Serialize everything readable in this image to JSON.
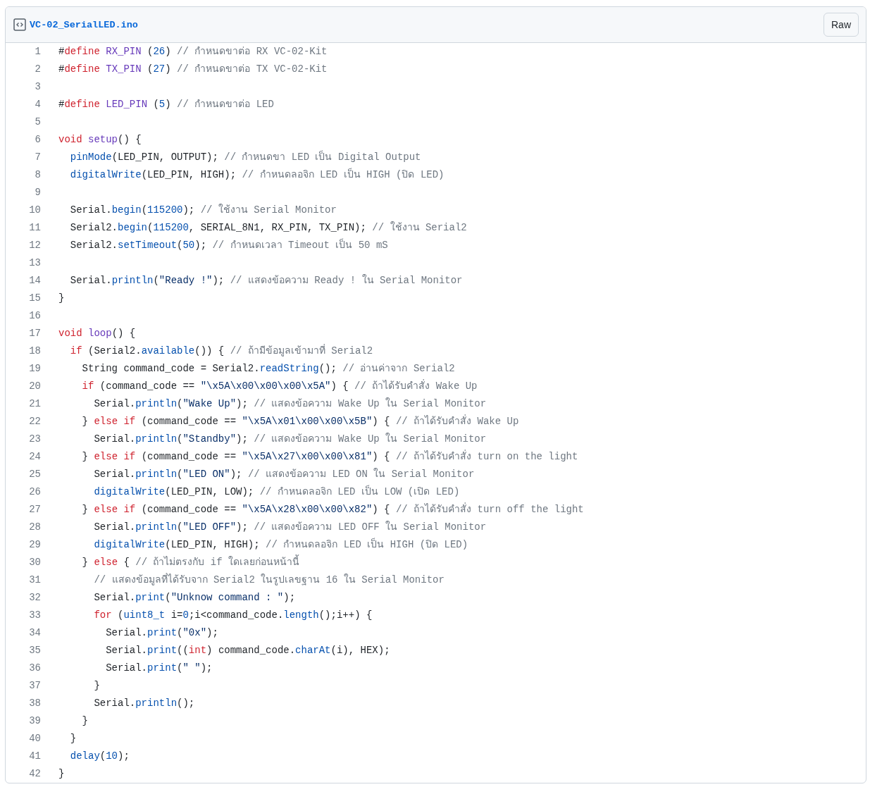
{
  "file": {
    "name": "VC-02_SerialLED.ino",
    "raw_button": "Raw"
  },
  "lines": [
    {
      "number": "1",
      "tokens": [
        {
          "kind": "plain",
          "text": "#"
        },
        {
          "kind": "keyword",
          "text": "define"
        },
        {
          "kind": "entity",
          "text": " RX_PIN"
        },
        {
          "kind": "plain",
          "text": " ("
        },
        {
          "kind": "constant",
          "text": "26"
        },
        {
          "kind": "plain",
          "text": ") "
        },
        {
          "kind": "comment",
          "text": "// กำหนดขาต่อ RX VC-02-Kit"
        }
      ]
    },
    {
      "number": "2",
      "tokens": [
        {
          "kind": "plain",
          "text": "#"
        },
        {
          "kind": "keyword",
          "text": "define"
        },
        {
          "kind": "entity",
          "text": " TX_PIN"
        },
        {
          "kind": "plain",
          "text": " ("
        },
        {
          "kind": "constant",
          "text": "27"
        },
        {
          "kind": "plain",
          "text": ") "
        },
        {
          "kind": "comment",
          "text": "// กำหนดขาต่อ TX VC-02-Kit"
        }
      ]
    },
    {
      "number": "3"
    },
    {
      "number": "4",
      "tokens": [
        {
          "kind": "plain",
          "text": "#"
        },
        {
          "kind": "keyword",
          "text": "define"
        },
        {
          "kind": "entity",
          "text": " LED_PIN"
        },
        {
          "kind": "plain",
          "text": " ("
        },
        {
          "kind": "constant",
          "text": "5"
        },
        {
          "kind": "plain",
          "text": ") "
        },
        {
          "kind": "comment",
          "text": "// กำหนดขาต่อ LED"
        }
      ]
    },
    {
      "number": "5"
    },
    {
      "number": "6",
      "tokens": [
        {
          "kind": "keyword",
          "text": "void"
        },
        {
          "kind": "entity",
          "text": " setup"
        },
        {
          "kind": "plain",
          "text": "() {"
        }
      ]
    },
    {
      "number": "7",
      "tokens": [
        {
          "kind": "constant",
          "text": "  pinMode"
        },
        {
          "kind": "plain",
          "text": "(LED_PIN, OUTPUT); "
        },
        {
          "kind": "comment",
          "text": "// กำหนดขา LED เป็น Digital Output"
        }
      ]
    },
    {
      "number": "8",
      "tokens": [
        {
          "kind": "constant",
          "text": "  digitalWrite"
        },
        {
          "kind": "plain",
          "text": "(LED_PIN, HIGH); "
        },
        {
          "kind": "comment",
          "text": "// กำหนดลอจิก LED เป็น HIGH (ปิด LED)"
        }
      ]
    },
    {
      "number": "9"
    },
    {
      "number": "10",
      "tokens": [
        {
          "kind": "plain",
          "text": "  Serial."
        },
        {
          "kind": "constant",
          "text": "begin"
        },
        {
          "kind": "plain",
          "text": "("
        },
        {
          "kind": "constant",
          "text": "115200"
        },
        {
          "kind": "plain",
          "text": "); "
        },
        {
          "kind": "comment",
          "text": "// ใช้งาน Serial Monitor"
        }
      ]
    },
    {
      "number": "11",
      "tokens": [
        {
          "kind": "plain",
          "text": "  Serial2."
        },
        {
          "kind": "constant",
          "text": "begin"
        },
        {
          "kind": "plain",
          "text": "("
        },
        {
          "kind": "constant",
          "text": "115200"
        },
        {
          "kind": "plain",
          "text": ", SERIAL_8N1, RX_PIN, TX_PIN); "
        },
        {
          "kind": "comment",
          "text": "// ใช้งาน Serial2"
        }
      ]
    },
    {
      "number": "12",
      "tokens": [
        {
          "kind": "plain",
          "text": "  Serial2."
        },
        {
          "kind": "constant",
          "text": "setTimeout"
        },
        {
          "kind": "plain",
          "text": "("
        },
        {
          "kind": "constant",
          "text": "50"
        },
        {
          "kind": "plain",
          "text": "); "
        },
        {
          "kind": "comment",
          "text": "// กำหนดเวลา Timeout เป็น 50 mS"
        }
      ]
    },
    {
      "number": "13"
    },
    {
      "number": "14",
      "tokens": [
        {
          "kind": "plain",
          "text": "  Serial."
        },
        {
          "kind": "constant",
          "text": "println"
        },
        {
          "kind": "plain",
          "text": "("
        },
        {
          "kind": "string",
          "text": "\"Ready !\""
        },
        {
          "kind": "plain",
          "text": "); "
        },
        {
          "kind": "comment",
          "text": "// แสดงข้อความ Ready ! ใน Serial Monitor"
        }
      ]
    },
    {
      "number": "15",
      "tokens": [
        {
          "kind": "plain",
          "text": "}"
        }
      ]
    },
    {
      "number": "16"
    },
    {
      "number": "17",
      "tokens": [
        {
          "kind": "keyword",
          "text": "void"
        },
        {
          "kind": "entity",
          "text": " loop"
        },
        {
          "kind": "plain",
          "text": "() {"
        }
      ]
    },
    {
      "number": "18",
      "tokens": [
        {
          "kind": "keyword",
          "text": "  if"
        },
        {
          "kind": "plain",
          "text": " (Serial2."
        },
        {
          "kind": "constant",
          "text": "available"
        },
        {
          "kind": "plain",
          "text": "()) { "
        },
        {
          "kind": "comment",
          "text": "// ถ้ามีข้อมูลเข้ามาที่ Serial2"
        }
      ]
    },
    {
      "number": "19",
      "tokens": [
        {
          "kind": "plain",
          "text": "    String command_code = Serial2."
        },
        {
          "kind": "constant",
          "text": "readString"
        },
        {
          "kind": "plain",
          "text": "(); "
        },
        {
          "kind": "comment",
          "text": "// อ่านค่าจาก Serial2"
        }
      ]
    },
    {
      "number": "20",
      "tokens": [
        {
          "kind": "keyword",
          "text": "    if"
        },
        {
          "kind": "plain",
          "text": " (command_code == "
        },
        {
          "kind": "string",
          "text": "\"\\x5A\\x00\\x00\\x00\\x5A\""
        },
        {
          "kind": "plain",
          "text": ") { "
        },
        {
          "kind": "comment",
          "text": "// ถ้าได้รับคำสั่ง Wake Up"
        }
      ]
    },
    {
      "number": "21",
      "tokens": [
        {
          "kind": "plain",
          "text": "      Serial."
        },
        {
          "kind": "constant",
          "text": "println"
        },
        {
          "kind": "plain",
          "text": "("
        },
        {
          "kind": "string",
          "text": "\"Wake Up\""
        },
        {
          "kind": "plain",
          "text": "); "
        },
        {
          "kind": "comment",
          "text": "// แสดงข้อความ Wake Up ใน Serial Monitor"
        }
      ]
    },
    {
      "number": "22",
      "tokens": [
        {
          "kind": "plain",
          "text": "    } "
        },
        {
          "kind": "keyword",
          "text": "else if"
        },
        {
          "kind": "plain",
          "text": " (command_code == "
        },
        {
          "kind": "string",
          "text": "\"\\x5A\\x01\\x00\\x00\\x5B\""
        },
        {
          "kind": "plain",
          "text": ") { "
        },
        {
          "kind": "comment",
          "text": "// ถ้าได้รับคำสั่ง Wake Up"
        }
      ]
    },
    {
      "number": "23",
      "tokens": [
        {
          "kind": "plain",
          "text": "      Serial."
        },
        {
          "kind": "constant",
          "text": "println"
        },
        {
          "kind": "plain",
          "text": "("
        },
        {
          "kind": "string",
          "text": "\"Standby\""
        },
        {
          "kind": "plain",
          "text": "); "
        },
        {
          "kind": "comment",
          "text": "// แสดงข้อความ Wake Up ใน Serial Monitor"
        }
      ]
    },
    {
      "number": "24",
      "tokens": [
        {
          "kind": "plain",
          "text": "    } "
        },
        {
          "kind": "keyword",
          "text": "else if"
        },
        {
          "kind": "plain",
          "text": " (command_code == "
        },
        {
          "kind": "string",
          "text": "\"\\x5A\\x27\\x00\\x00\\x81\""
        },
        {
          "kind": "plain",
          "text": ") { "
        },
        {
          "kind": "comment",
          "text": "// ถ้าได้รับคำสั่ง turn on the light"
        }
      ]
    },
    {
      "number": "25",
      "tokens": [
        {
          "kind": "plain",
          "text": "      Serial."
        },
        {
          "kind": "constant",
          "text": "println"
        },
        {
          "kind": "plain",
          "text": "("
        },
        {
          "kind": "string",
          "text": "\"LED ON\""
        },
        {
          "kind": "plain",
          "text": "); "
        },
        {
          "kind": "comment",
          "text": "// แสดงข้อความ LED ON ใน Serial Monitor"
        }
      ]
    },
    {
      "number": "26",
      "tokens": [
        {
          "kind": "constant",
          "text": "      digitalWrite"
        },
        {
          "kind": "plain",
          "text": "(LED_PIN, LOW); "
        },
        {
          "kind": "comment",
          "text": "// กำหนดลอจิก LED เป็น LOW (เปิด LED)"
        }
      ]
    },
    {
      "number": "27",
      "tokens": [
        {
          "kind": "plain",
          "text": "    } "
        },
        {
          "kind": "keyword",
          "text": "else if"
        },
        {
          "kind": "plain",
          "text": " (command_code == "
        },
        {
          "kind": "string",
          "text": "\"\\x5A\\x28\\x00\\x00\\x82\""
        },
        {
          "kind": "plain",
          "text": ") { "
        },
        {
          "kind": "comment",
          "text": "// ถ้าได้รับคำสั่ง turn off the light"
        }
      ]
    },
    {
      "number": "28",
      "tokens": [
        {
          "kind": "plain",
          "text": "      Serial."
        },
        {
          "kind": "constant",
          "text": "println"
        },
        {
          "kind": "plain",
          "text": "("
        },
        {
          "kind": "string",
          "text": "\"LED OFF\""
        },
        {
          "kind": "plain",
          "text": "); "
        },
        {
          "kind": "comment",
          "text": "// แสดงข้อความ LED OFF ใน Serial Monitor"
        }
      ]
    },
    {
      "number": "29",
      "tokens": [
        {
          "kind": "constant",
          "text": "      digitalWrite"
        },
        {
          "kind": "plain",
          "text": "(LED_PIN, HIGH); "
        },
        {
          "kind": "comment",
          "text": "// กำหนดลอจิก LED เป็น HIGH (ปิด LED)"
        }
      ]
    },
    {
      "number": "30",
      "tokens": [
        {
          "kind": "plain",
          "text": "    } "
        },
        {
          "kind": "keyword",
          "text": "else"
        },
        {
          "kind": "plain",
          "text": " { "
        },
        {
          "kind": "comment",
          "text": "// ถ้าไม่ตรงกับ if ใดเลยก่อนหน้านี้"
        }
      ]
    },
    {
      "number": "31",
      "tokens": [
        {
          "kind": "comment",
          "text": "      // แสดงข้อมูลที่ได้รับจาก Serial2 ในรูปเลขฐาน 16 ใน Serial Monitor"
        }
      ]
    },
    {
      "number": "32",
      "tokens": [
        {
          "kind": "plain",
          "text": "      Serial."
        },
        {
          "kind": "constant",
          "text": "print"
        },
        {
          "kind": "plain",
          "text": "("
        },
        {
          "kind": "string",
          "text": "\"Unknow command : \""
        },
        {
          "kind": "plain",
          "text": ");"
        }
      ]
    },
    {
      "number": "33",
      "tokens": [
        {
          "kind": "keyword",
          "text": "      for"
        },
        {
          "kind": "plain",
          "text": " ("
        },
        {
          "kind": "constant",
          "text": "uint8_t"
        },
        {
          "kind": "plain",
          "text": " i="
        },
        {
          "kind": "constant",
          "text": "0"
        },
        {
          "kind": "plain",
          "text": ";i<command_code."
        },
        {
          "kind": "constant",
          "text": "length"
        },
        {
          "kind": "plain",
          "text": "();i++) {"
        }
      ]
    },
    {
      "number": "34",
      "tokens": [
        {
          "kind": "plain",
          "text": "        Serial."
        },
        {
          "kind": "constant",
          "text": "print"
        },
        {
          "kind": "plain",
          "text": "("
        },
        {
          "kind": "string",
          "text": "\"0x\""
        },
        {
          "kind": "plain",
          "text": ");"
        }
      ]
    },
    {
      "number": "35",
      "tokens": [
        {
          "kind": "plain",
          "text": "        Serial."
        },
        {
          "kind": "constant",
          "text": "print"
        },
        {
          "kind": "plain",
          "text": "(("
        },
        {
          "kind": "keyword",
          "text": "int"
        },
        {
          "kind": "plain",
          "text": ") command_code."
        },
        {
          "kind": "constant",
          "text": "charAt"
        },
        {
          "kind": "plain",
          "text": "(i), HEX);"
        }
      ]
    },
    {
      "number": "36",
      "tokens": [
        {
          "kind": "plain",
          "text": "        Serial."
        },
        {
          "kind": "constant",
          "text": "print"
        },
        {
          "kind": "plain",
          "text": "("
        },
        {
          "kind": "string",
          "text": "\" \""
        },
        {
          "kind": "plain",
          "text": ");"
        }
      ]
    },
    {
      "number": "37",
      "tokens": [
        {
          "kind": "plain",
          "text": "      }"
        }
      ]
    },
    {
      "number": "38",
      "tokens": [
        {
          "kind": "plain",
          "text": "      Serial."
        },
        {
          "kind": "constant",
          "text": "println"
        },
        {
          "kind": "plain",
          "text": "();"
        }
      ]
    },
    {
      "number": "39",
      "tokens": [
        {
          "kind": "plain",
          "text": "    }"
        }
      ]
    },
    {
      "number": "40",
      "tokens": [
        {
          "kind": "plain",
          "text": "  }"
        }
      ]
    },
    {
      "number": "41",
      "tokens": [
        {
          "kind": "constant",
          "text": "  delay"
        },
        {
          "kind": "plain",
          "text": "("
        },
        {
          "kind": "constant",
          "text": "10"
        },
        {
          "kind": "plain",
          "text": ");"
        }
      ]
    },
    {
      "number": "42",
      "tokens": [
        {
          "kind": "plain",
          "text": "}"
        }
      ]
    }
  ]
}
